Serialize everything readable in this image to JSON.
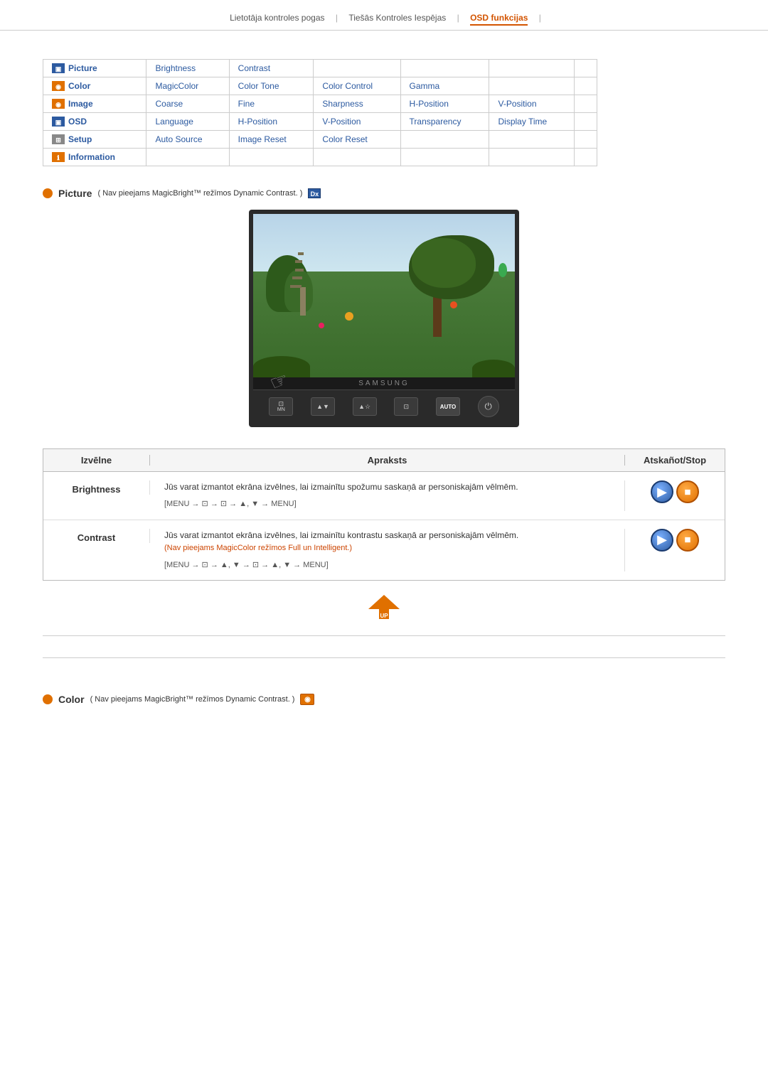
{
  "topnav": {
    "links": [
      {
        "label": "Lietotāja kontroles pogas",
        "active": false
      },
      {
        "label": "Tiešās Kontroles Iespējas",
        "active": false
      },
      {
        "label": "OSD funkcijas",
        "active": true
      }
    ]
  },
  "nav_table": {
    "rows": [
      {
        "category": "Picture",
        "icon_type": "blue",
        "items": [
          "Brightness",
          "Contrast",
          "",
          "",
          "",
          ""
        ]
      },
      {
        "category": "Color",
        "icon_type": "orange",
        "items": [
          "MagicColor",
          "Color Tone",
          "Color Control",
          "Gamma",
          "",
          ""
        ]
      },
      {
        "category": "Image",
        "icon_type": "orange",
        "items": [
          "Coarse",
          "Fine",
          "Sharpness",
          "H-Position",
          "V-Position",
          ""
        ]
      },
      {
        "category": "OSD",
        "icon_type": "blue",
        "items": [
          "Language",
          "H-Position",
          "V-Position",
          "Transparency",
          "Display Time",
          ""
        ]
      },
      {
        "category": "Setup",
        "icon_type": "gray",
        "items": [
          "Auto Source",
          "Image Reset",
          "Color Reset",
          "",
          "",
          ""
        ]
      },
      {
        "category": "Information",
        "icon_type": "orange",
        "items": [
          "",
          "",
          "",
          "",
          "",
          ""
        ]
      }
    ]
  },
  "picture_section": {
    "dot_color": "#e07000",
    "title": "Picture",
    "note": "( Nav pieejams MagicBright™ režīmos Dynamic Contrast. )",
    "icon_label": "Dx"
  },
  "monitor": {
    "brand": "SAMSUNG",
    "controls": [
      "MN",
      "▲▼",
      "▲☆",
      "⊡",
      "AUTO",
      "⏻"
    ]
  },
  "desc_table": {
    "headers": {
      "menu": "Izvēlne",
      "description": "Apraksts",
      "action": "Atskañot/Stop"
    },
    "rows": [
      {
        "menu": "Brightness",
        "desc_main": "Jūs varat izmantot ekrāna izvēlnes, lai izmainītu spožumu saskaņā ar personiskajām vēlmēm.",
        "desc_path": "[MENU → ⊡ → ⊡ → ▲, ▼ → MENU]",
        "nav_note": "",
        "btn_color": "blue"
      },
      {
        "menu": "Contrast",
        "desc_main": "Jūs varat izmantot ekrāna izvēlnes, lai izmainītu kontrastu saskaņā ar personiskajām vēlmēm.",
        "desc_path": "[MENU → ⊡ → ▲, ▼ → ⊡ → ▲, ▼ → MENU]",
        "nav_note": "(Nav pieejams MagicColor režīmos Full un Intelligent.)",
        "btn_color": "blue"
      }
    ]
  },
  "up_arrow": {
    "label": "UP"
  },
  "color_section": {
    "dot_color": "#e07000",
    "title": "Color",
    "note": "( Nav pieejams MagicBright™ režīmos Dynamic Contrast. )",
    "icon_color": "#e07000"
  }
}
